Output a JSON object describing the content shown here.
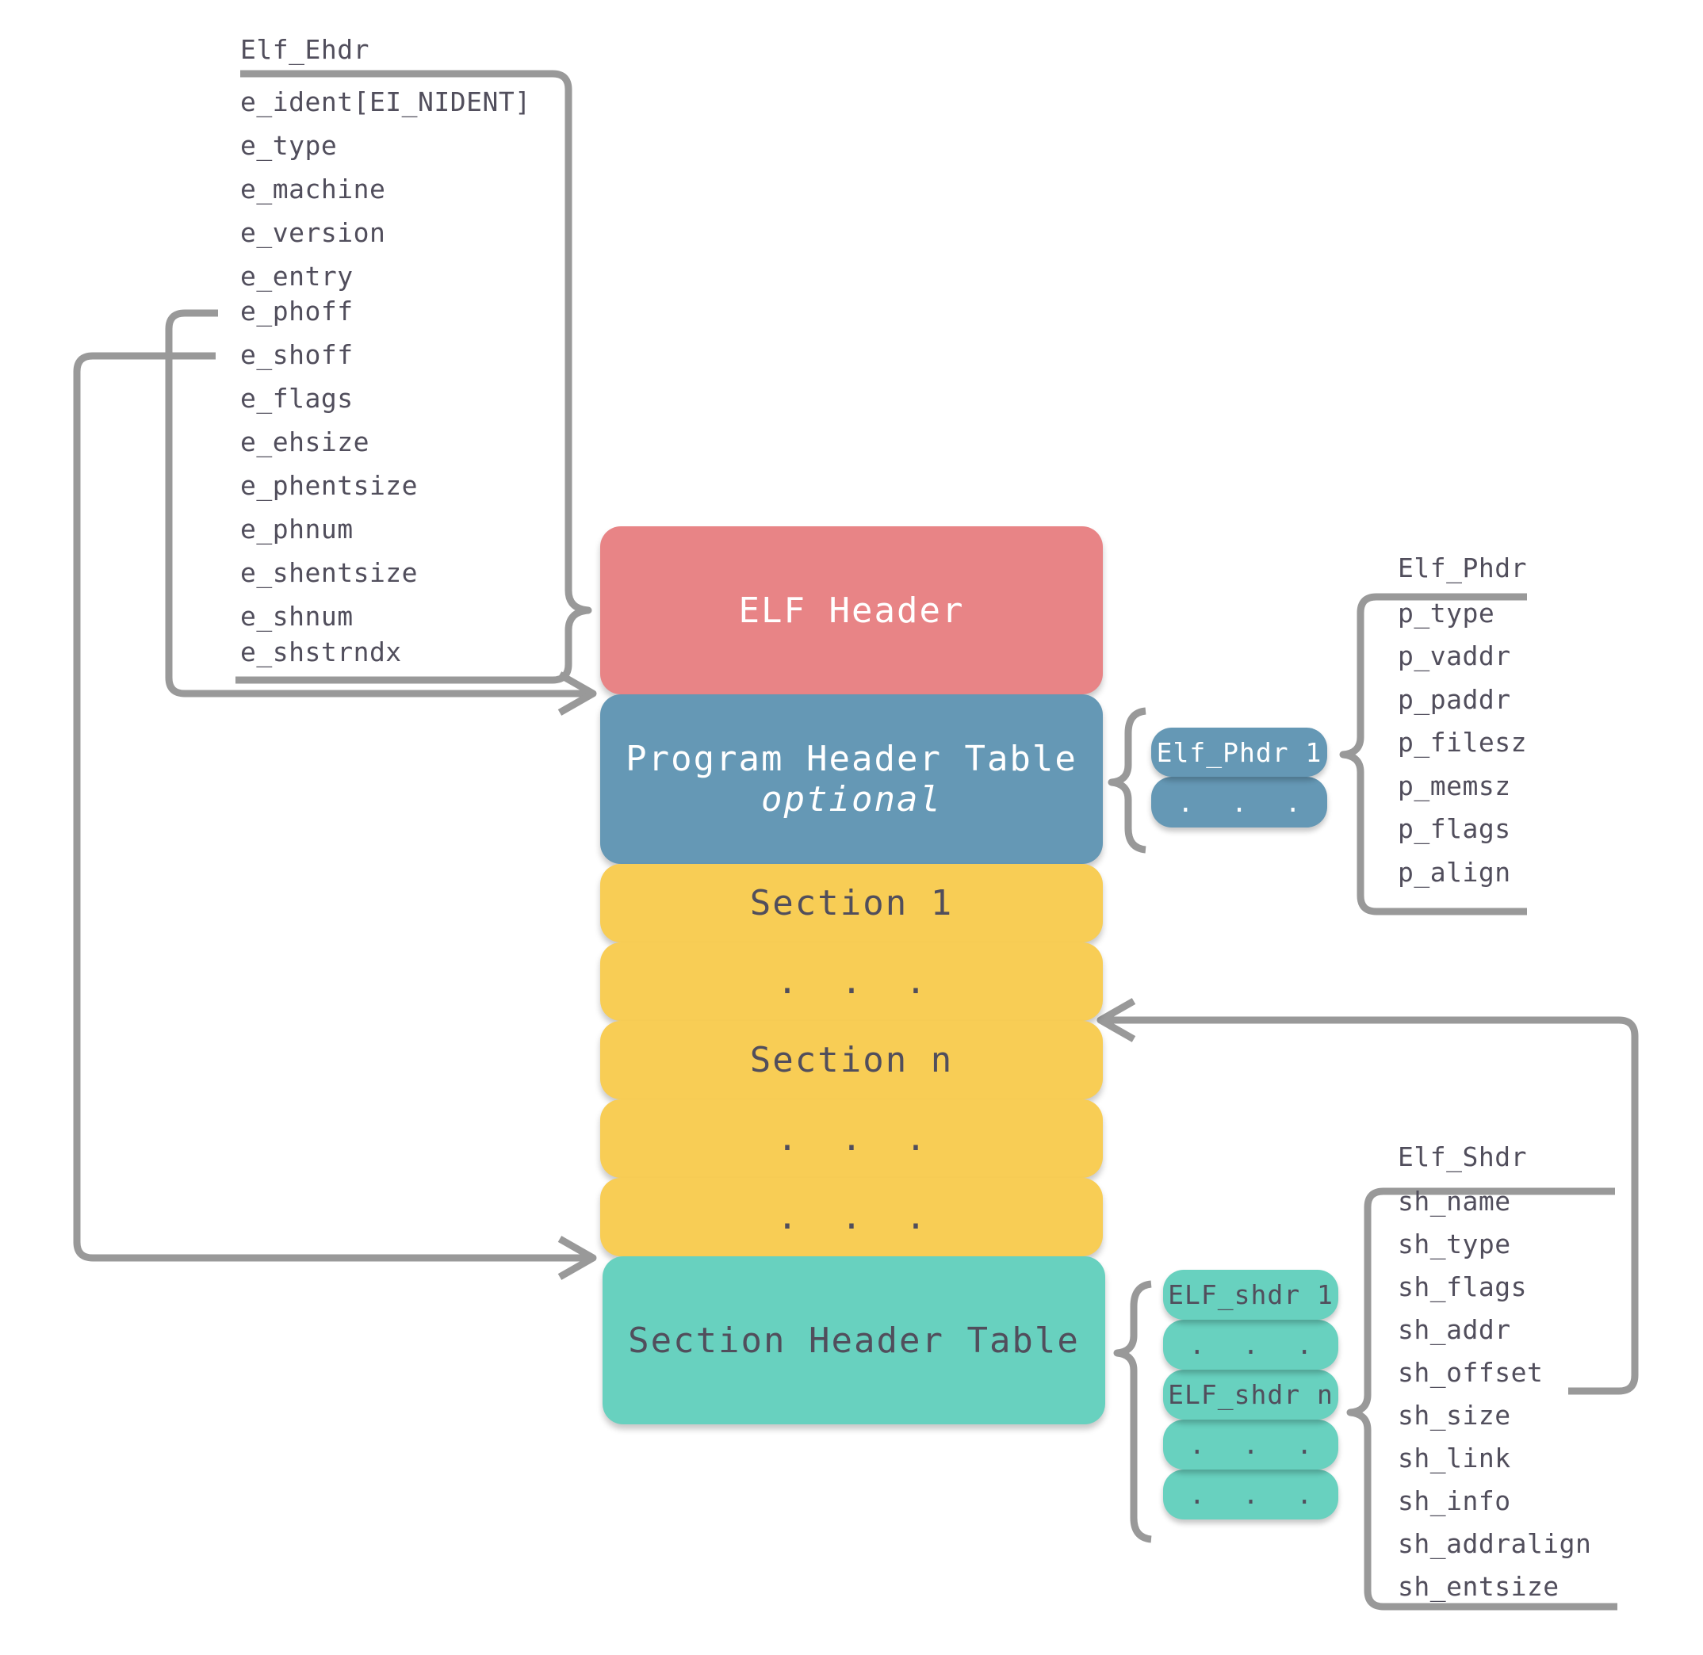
{
  "colors": {
    "elf_header": "#e88486",
    "program_header_table": "#6598b5",
    "section": "#f8cd55",
    "section_header_table": "#68d1bf",
    "connector": "#999999",
    "text_dark": "#514e5c",
    "text_light": "#ffffff"
  },
  "ehdr": {
    "title": "Elf_Ehdr",
    "fields": [
      "e_ident[EI_NIDENT]",
      "e_type",
      "e_machine",
      "e_version",
      "e_entry",
      "e_phoff",
      "e_shoff",
      "e_flags",
      "e_ehsize",
      "e_phentsize",
      "e_phnum",
      "e_shentsize",
      "e_shnum",
      "e_shstrndx"
    ]
  },
  "file_layout": {
    "elf_header": "ELF Header",
    "program_header_table": {
      "label": "Program Header Table",
      "note": "optional"
    },
    "sections": [
      "Section 1",
      ". . .",
      "Section n",
      ". . .",
      ". . ."
    ],
    "section_header_table": "Section Header Table"
  },
  "phdr_entries": [
    "Elf_Phdr 1",
    ". . ."
  ],
  "phdr": {
    "title": "Elf_Phdr",
    "fields": [
      "p_type",
      "p_vaddr",
      "p_paddr",
      "p_filesz",
      "p_memsz",
      "p_flags",
      "p_align"
    ]
  },
  "shdr_entries": [
    "ELF_shdr 1",
    ". . .",
    "ELF_shdr n",
    ". . .",
    ". . ."
  ],
  "shdr": {
    "title": "Elf_Shdr",
    "fields": [
      "sh_name",
      "sh_type",
      "sh_flags",
      "sh_addr",
      "sh_offset",
      "sh_size",
      "sh_link",
      "sh_info",
      "sh_addralign",
      "sh_entsize"
    ]
  },
  "connections": [
    {
      "from": "e_phoff",
      "to": "Program Header Table"
    },
    {
      "from": "e_shoff",
      "to": "Section Header Table"
    },
    {
      "from": "sh_offset",
      "to": "Section n"
    }
  ]
}
